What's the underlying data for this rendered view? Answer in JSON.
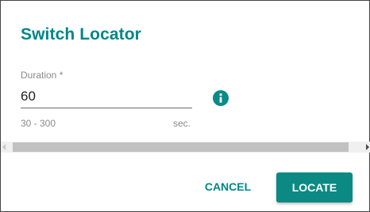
{
  "dialog": {
    "title": "Switch Locator"
  },
  "duration_field": {
    "label": "Duration *",
    "value": "60",
    "range_hint": "30 - 300",
    "unit_hint": "sec.",
    "info_icon": "info-icon"
  },
  "actions": {
    "cancel_label": "CANCEL",
    "locate_label": "LOCATE"
  },
  "colors": {
    "accent": "#008787",
    "button_bg": "#0b8a84"
  }
}
